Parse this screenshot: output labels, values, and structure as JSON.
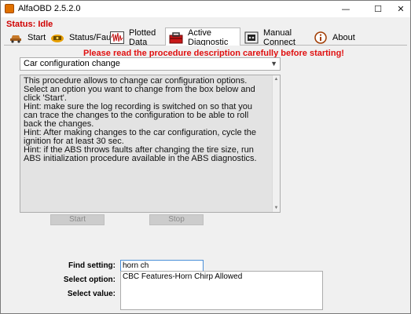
{
  "window": {
    "title": "AlfaOBD 2.5.2.0",
    "controls": {
      "minimize": "—",
      "maximize": "☐",
      "close": "✕"
    }
  },
  "status": {
    "text": "Status: Idle",
    "color": "#d00000"
  },
  "tabs": [
    {
      "label": "Start",
      "icon": "car-icon"
    },
    {
      "label": "Status/Faults",
      "icon": "ecu-icon"
    },
    {
      "label": "Plotted Data",
      "icon": "waveform-icon"
    },
    {
      "label": "Active Diagnostic",
      "icon": "toolbox-icon",
      "active": true
    },
    {
      "label": "Manual Connect",
      "icon": "connector-icon"
    },
    {
      "label": "About",
      "icon": "info-icon"
    }
  ],
  "active_diagnostic": {
    "warning": "Please read the procedure description carefully before starting!",
    "procedure_selected": "Car configuration change",
    "description": "This procedure allows to change car configuration options.\nSelect an option you want to change from the box below and click 'Start'.\nHint: make sure the log recording is switched on so that you can trace the changes to the configuration to be able to roll back the changes.\nHint: After making changes to the car configuration, cycle the ignition for at least 30 sec.\nHint: if the ABS throws faults after changing the tire size, run ABS initialization procedure available in the ABS diagnostics.",
    "start_label": "Start",
    "stop_label": "Stop",
    "find_label": "Find setting:",
    "find_value": "horn ch",
    "option_label": "Select option:",
    "value_label": "Select value:",
    "options": [
      "CBC Features-Horn Chirp Allowed"
    ]
  },
  "colors": {
    "warning": "#e01010",
    "accent": "#4a8fd8"
  }
}
